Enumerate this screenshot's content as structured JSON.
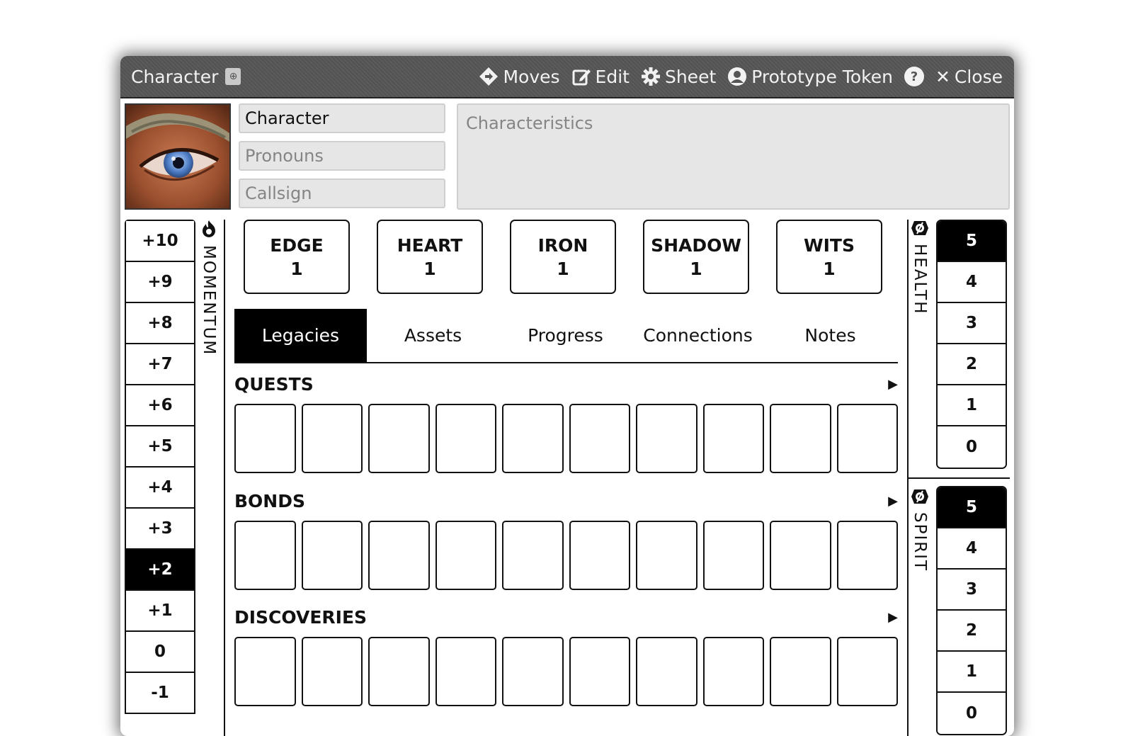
{
  "window": {
    "title": "Character",
    "title_badge": "⊕",
    "actions": [
      {
        "label": "Moves",
        "icon": "moves-icon"
      },
      {
        "label": "Edit",
        "icon": "edit-icon"
      },
      {
        "label": "Sheet",
        "icon": "gear-icon"
      },
      {
        "label": "Prototype Token",
        "icon": "user-circle-icon"
      },
      {
        "label": "",
        "icon": "help-icon"
      },
      {
        "label": "Close",
        "icon": "close-icon"
      }
    ],
    "help_glyph": "?",
    "close_glyph": "✕"
  },
  "profile": {
    "name_value": "Character",
    "pronouns_placeholder": "Pronouns",
    "callsign_placeholder": "Callsign",
    "characteristics_placeholder": "Characteristics"
  },
  "momentum": {
    "label": "MOMENTUM",
    "values": [
      "+10",
      "+9",
      "+8",
      "+7",
      "+6",
      "+5",
      "+4",
      "+3",
      "+2",
      "+1",
      "0",
      "-1"
    ],
    "current": "+2"
  },
  "stats": [
    {
      "name": "EDGE",
      "value": "1"
    },
    {
      "name": "HEART",
      "value": "1"
    },
    {
      "name": "IRON",
      "value": "1"
    },
    {
      "name": "SHADOW",
      "value": "1"
    },
    {
      "name": "WITS",
      "value": "1"
    }
  ],
  "tabs": [
    "Legacies",
    "Assets",
    "Progress",
    "Connections",
    "Notes"
  ],
  "active_tab": "Legacies",
  "legacies": [
    {
      "title": "QUESTS"
    },
    {
      "title": "BONDS"
    },
    {
      "title": "DISCOVERIES"
    }
  ],
  "meters": {
    "health": {
      "label": "HEALTH",
      "values": [
        "5",
        "4",
        "3",
        "2",
        "1",
        "0"
      ],
      "current": "5"
    },
    "spirit": {
      "label": "SPIRIT",
      "values": [
        "5",
        "4",
        "3",
        "2",
        "1",
        "0"
      ],
      "current": "5"
    }
  },
  "colors": {
    "titlebar": "#555555",
    "field_bg": "#e6e6e6",
    "active": "#000000",
    "ink": "#111111"
  }
}
